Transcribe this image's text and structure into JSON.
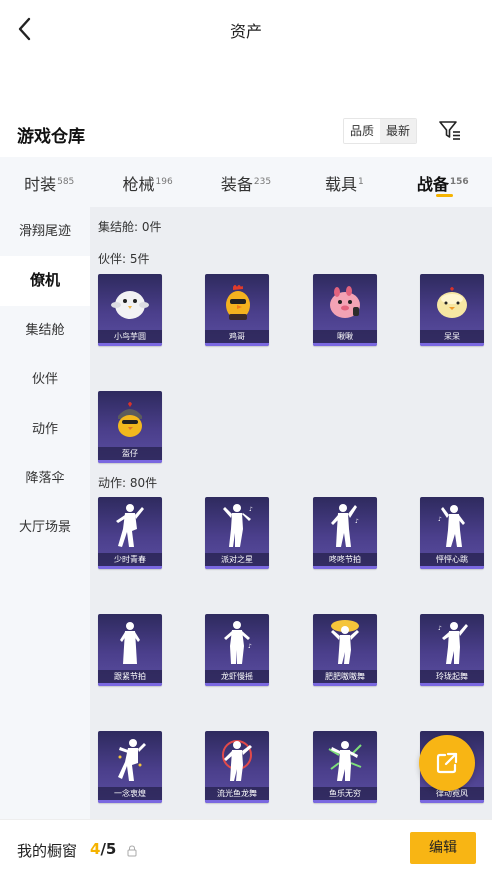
{
  "header": {
    "title": "资产",
    "back_icon": "chevron-left-icon"
  },
  "section": {
    "title": "游戏仓库",
    "sort_options": [
      {
        "label": "品质",
        "active": false
      },
      {
        "label": "最新",
        "active": true
      }
    ],
    "filter_icon": "filter-icon"
  },
  "tabs": [
    {
      "label": "时装",
      "count": "585",
      "active": false
    },
    {
      "label": "枪械",
      "count": "196",
      "active": false
    },
    {
      "label": "装备",
      "count": "235",
      "active": false
    },
    {
      "label": "载具",
      "count": "1",
      "active": false
    },
    {
      "label": "战备",
      "count": "156",
      "active": true
    }
  ],
  "sidebar": {
    "items": [
      {
        "label": "滑翔尾迹",
        "active": false
      },
      {
        "label": "僚机",
        "active": true
      },
      {
        "label": "集结舱",
        "active": false
      },
      {
        "label": "伙伴",
        "active": false
      },
      {
        "label": "动作",
        "active": false
      },
      {
        "label": "降落伞",
        "active": false
      },
      {
        "label": "大厅场景",
        "active": false
      }
    ]
  },
  "content": {
    "groups": [
      {
        "label": "集结舱: 0件",
        "items": []
      },
      {
        "label": "伙伴: 5件",
        "items": [
          {
            "name": "小鸟芋圆",
            "icon": "white-bird-icon"
          },
          {
            "name": "鸡哥",
            "icon": "rooster-icon"
          },
          {
            "name": "啾啾",
            "icon": "pink-bird-icon"
          },
          {
            "name": "呆呆",
            "icon": "yellow-chick-icon"
          },
          {
            "name": "盔仔",
            "icon": "helmet-chick-icon"
          }
        ]
      },
      {
        "label": "动作: 80件",
        "items": [
          {
            "name": "少时青春",
            "icon": "dancer-icon"
          },
          {
            "name": "派对之星",
            "icon": "dancer-icon"
          },
          {
            "name": "咚咚节拍",
            "icon": "dancer-icon"
          },
          {
            "name": "怦怦心跳",
            "icon": "dancer-icon"
          },
          {
            "name": "跟紧节拍",
            "icon": "dancer-icon"
          },
          {
            "name": "龙虾慢摇",
            "icon": "dancer-icon"
          },
          {
            "name": "肥肥嗷嗷舞",
            "icon": "dancer-icon"
          },
          {
            "name": "玲珑起舞",
            "icon": "dancer-icon"
          },
          {
            "name": "一念衷煌",
            "icon": "dancer-icon"
          },
          {
            "name": "流光鱼龙舞",
            "icon": "dancer-icon"
          },
          {
            "name": "鱼乐无穷",
            "icon": "dancer-icon"
          },
          {
            "name": "律动霓风",
            "icon": "dancer-icon"
          }
        ]
      }
    ]
  },
  "fab": {
    "icon": "share-external-icon"
  },
  "footer": {
    "label": "我的橱窗",
    "count_current": "4",
    "count_sep": "/",
    "count_total": "5",
    "lock_icon": "lock-icon",
    "edit_label": "编辑"
  },
  "colors": {
    "accent": "#f8b514",
    "card_bg": "#4b3f8c",
    "tab_underline": "#f5b300"
  }
}
